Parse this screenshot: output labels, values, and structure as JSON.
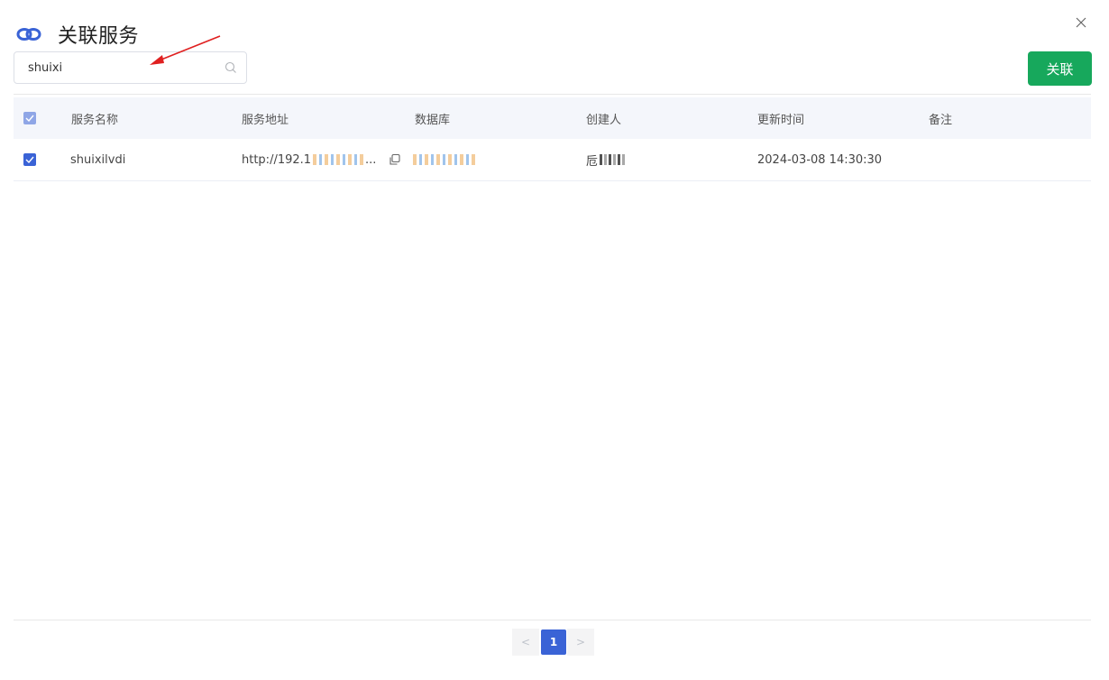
{
  "dialog": {
    "title": "关联服务",
    "close_label": "×",
    "primary_button": "关联",
    "accent_color": "#17a85c",
    "brand_color": "#3a63d6"
  },
  "search": {
    "value": "shuixi",
    "icon": "search-icon"
  },
  "table": {
    "columns": [
      "服务名称",
      "服务地址",
      "数据库",
      "创建人",
      "更新时间",
      "备注"
    ],
    "rows": [
      {
        "checked": true,
        "name": "shuixilvdi",
        "address": "http://192.1",
        "address_suffix": "...",
        "database": "",
        "creator": "卮",
        "updated": "2024-03-08 14:30:30",
        "remark": ""
      }
    ]
  },
  "pagination": {
    "prev": "<",
    "current": "1",
    "next": ">"
  }
}
